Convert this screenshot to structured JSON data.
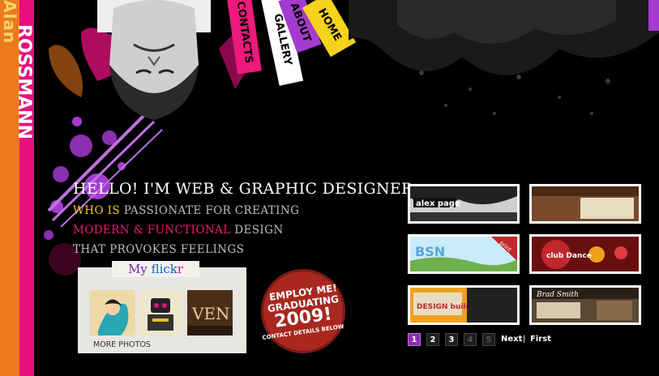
{
  "brand": {
    "first_name": "Alan",
    "last_name": "ROSSMANN"
  },
  "nav": {
    "items": [
      {
        "label": "CONTACTS",
        "color": "#ec1a7b"
      },
      {
        "label": "GALLERY",
        "color": "#ffffff"
      },
      {
        "label": "ABOUT",
        "color": "#a43bd0"
      },
      {
        "label": "HOME",
        "color": "#f5d21c"
      }
    ]
  },
  "intro": {
    "headline": "HELLO! I'M WEB & GRAPHIC DESIGNER",
    "line1_a": "WHO IS",
    "line1_b": " PASSIONATE FOR CREATING",
    "line2_a": "MODERN & FUNCTIONAL",
    "line2_b": " DESIGN",
    "line3": "THAT PROVOKES FEELINGS"
  },
  "flickr": {
    "title_my": "My ",
    "title_fl": "flick",
    "title_r": "r",
    "more_label": "MORE PHOTOS",
    "thumbs": [
      "girl-illustration-thumb",
      "robot-poster-thumb",
      "ven-typography-thumb"
    ]
  },
  "badge": {
    "line1": "EMPLOY ME!",
    "line2": "GRADUATING",
    "year": "2009!",
    "line4": "CONTACT DETAILS BELOW"
  },
  "portfolio": {
    "items": [
      {
        "title": "alex page",
        "tag": ""
      },
      {
        "title": "",
        "tag": ""
      },
      {
        "title": "BSN",
        "tag": "print"
      },
      {
        "title": "club Dance",
        "tag": ""
      },
      {
        "title": "DESIGN builder",
        "tag": ""
      },
      {
        "title": "Brad Smith",
        "tag": ""
      }
    ]
  },
  "pagination": {
    "pages": [
      "1",
      "2",
      "3",
      "4",
      "5"
    ],
    "active": "1",
    "next_label": "Next",
    "separator": "|",
    "first_label": "First"
  },
  "colors": {
    "accent_pink": "#e8107f",
    "accent_orange": "#ec7a1c",
    "accent_purple": "#a43bd0",
    "accent_yellow": "#f5c61a"
  }
}
